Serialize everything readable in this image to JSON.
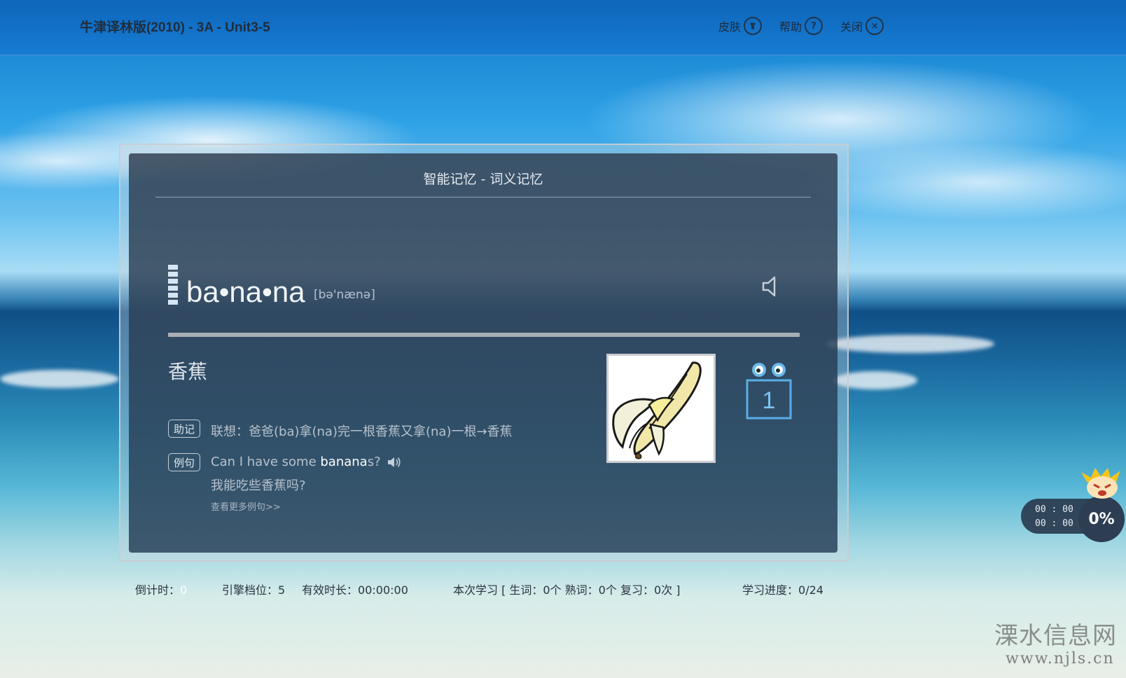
{
  "header": {
    "title": "牛津译林版(2010) - 3A - Unit3-5",
    "actions": [
      {
        "label": "皮肤",
        "icon": "skin-icon"
      },
      {
        "label": "帮助",
        "icon": "help-icon"
      },
      {
        "label": "关闭",
        "icon": "close-icon"
      }
    ]
  },
  "panel": {
    "title": "智能记忆 - 词义记忆",
    "word": "ba•na•na",
    "phonetic": "[bə'nænə]",
    "meaning": "香蕉",
    "mnemonic_tag": "助记",
    "mnemonic": "联想：爸爸(ba)拿(na)完一根香蕉又拿(na)一根→香蕉",
    "example_tag": "例句",
    "example_before": "Can I have some ",
    "example_highlight": "banana",
    "example_after": "s?",
    "example_translation": "我能吃些香蕉吗?",
    "more_examples": "查看更多例句>>",
    "review_count": "1",
    "image_icon": "banana-image"
  },
  "status": {
    "countdown_label": "倒计时：",
    "countdown_value": "0",
    "engine_label": "引擎档位：",
    "engine_value": "5",
    "duration_label": "有效时长：",
    "duration_value": "00:00:00",
    "session_text": "本次学习 [ 生词：0个 熟词：0个 复习：0次 ]",
    "progress_label": "学习进度：",
    "progress_value": "0/24"
  },
  "timer": {
    "line1": "00 : 00",
    "line2": "00 : 00",
    "percent": "0%"
  },
  "watermark": {
    "name": "溧水信息网",
    "url": "www.njls.cn"
  }
}
